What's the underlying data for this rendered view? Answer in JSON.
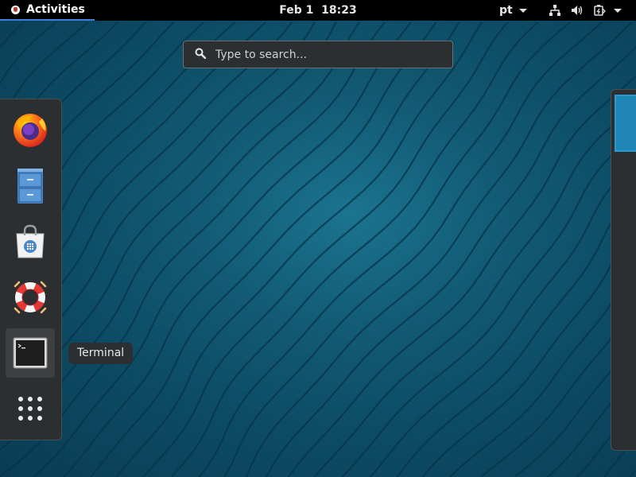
{
  "topbar": {
    "activities_label": "Activities",
    "date": "Feb 1",
    "time": "18:23",
    "language": "pt"
  },
  "search": {
    "placeholder": "Type to search..."
  },
  "dash": {
    "items": [
      {
        "name": "Firefox",
        "icon": "firefox-icon"
      },
      {
        "name": "Files",
        "icon": "file-cabinet-icon"
      },
      {
        "name": "Software",
        "icon": "shopping-bag-icon"
      },
      {
        "name": "Help",
        "icon": "lifebuoy-icon"
      },
      {
        "name": "Terminal",
        "icon": "terminal-icon",
        "active": true
      },
      {
        "name": "Show Applications",
        "icon": "app-grid-icon"
      }
    ],
    "tooltip": "Terminal"
  },
  "colors": {
    "topbar_bg": "#000000",
    "accent": "#3e7fd9",
    "wallpaper": "#125b76",
    "panel_bg": "#2b2f31"
  }
}
